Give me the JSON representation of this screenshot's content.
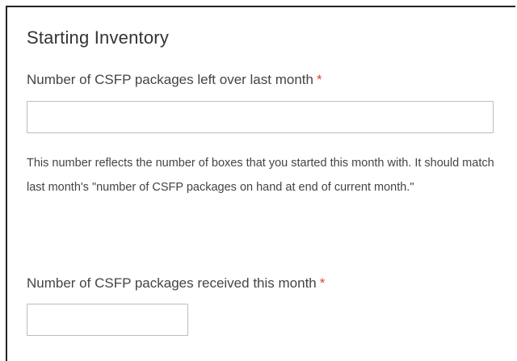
{
  "section": {
    "title": "Starting Inventory"
  },
  "fields": [
    {
      "label": "Number of CSFP packages left over last month",
      "required_marker": "*",
      "value": "",
      "help": "This number reflects the number of boxes that you started this month with. It should match last month's \"number of CSFP packages on hand at end of current month.\""
    },
    {
      "label": "Number of CSFP packages received this month",
      "required_marker": "*",
      "value": ""
    }
  ],
  "colors": {
    "required": "#d9443a",
    "border": "#bdbdbd"
  }
}
